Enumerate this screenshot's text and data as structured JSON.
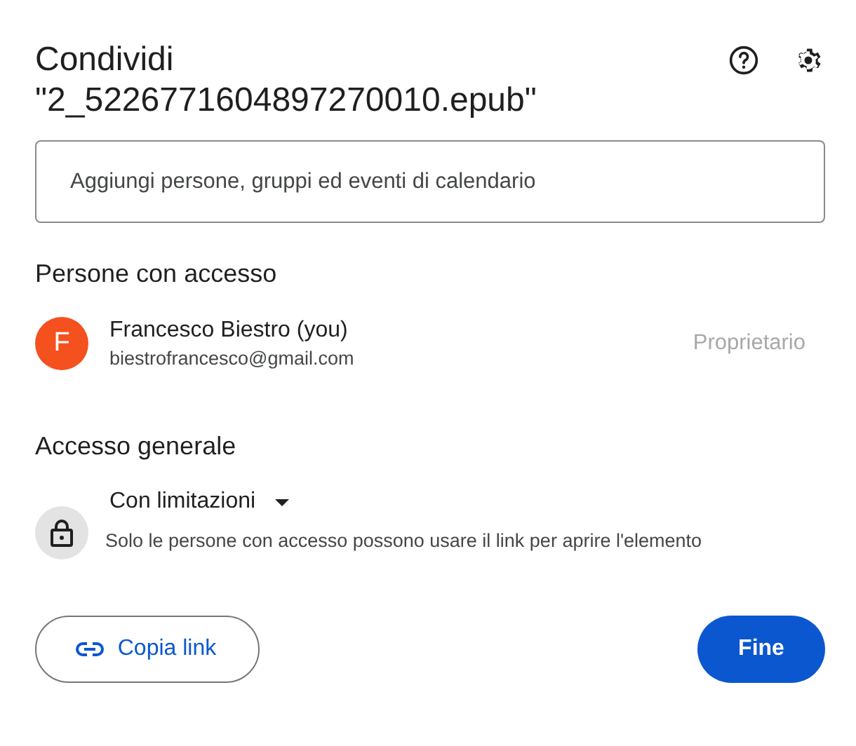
{
  "dialog": {
    "title": "Condividi",
    "file_name": "\"2_5226771604897270010.epub\""
  },
  "add_field": {
    "placeholder": "Aggiungi persone, gruppi ed eventi di calendario"
  },
  "people_section": {
    "heading": "Persone con accesso",
    "people": [
      {
        "initial": "F",
        "name": "Francesco Biestro (you)",
        "email": "biestrofrancesco@gmail.com",
        "role": "Proprietario",
        "color": "#f4511e"
      }
    ]
  },
  "general_access": {
    "heading": "Accesso generale",
    "setting": "Con limitazioni",
    "description": "Solo le persone con accesso possono usare il link per aprire l'elemento"
  },
  "buttons": [
    {
      "kind": "outlined",
      "label": "Copia link"
    },
    {
      "kind": "filled",
      "label": "Fine"
    }
  ]
}
